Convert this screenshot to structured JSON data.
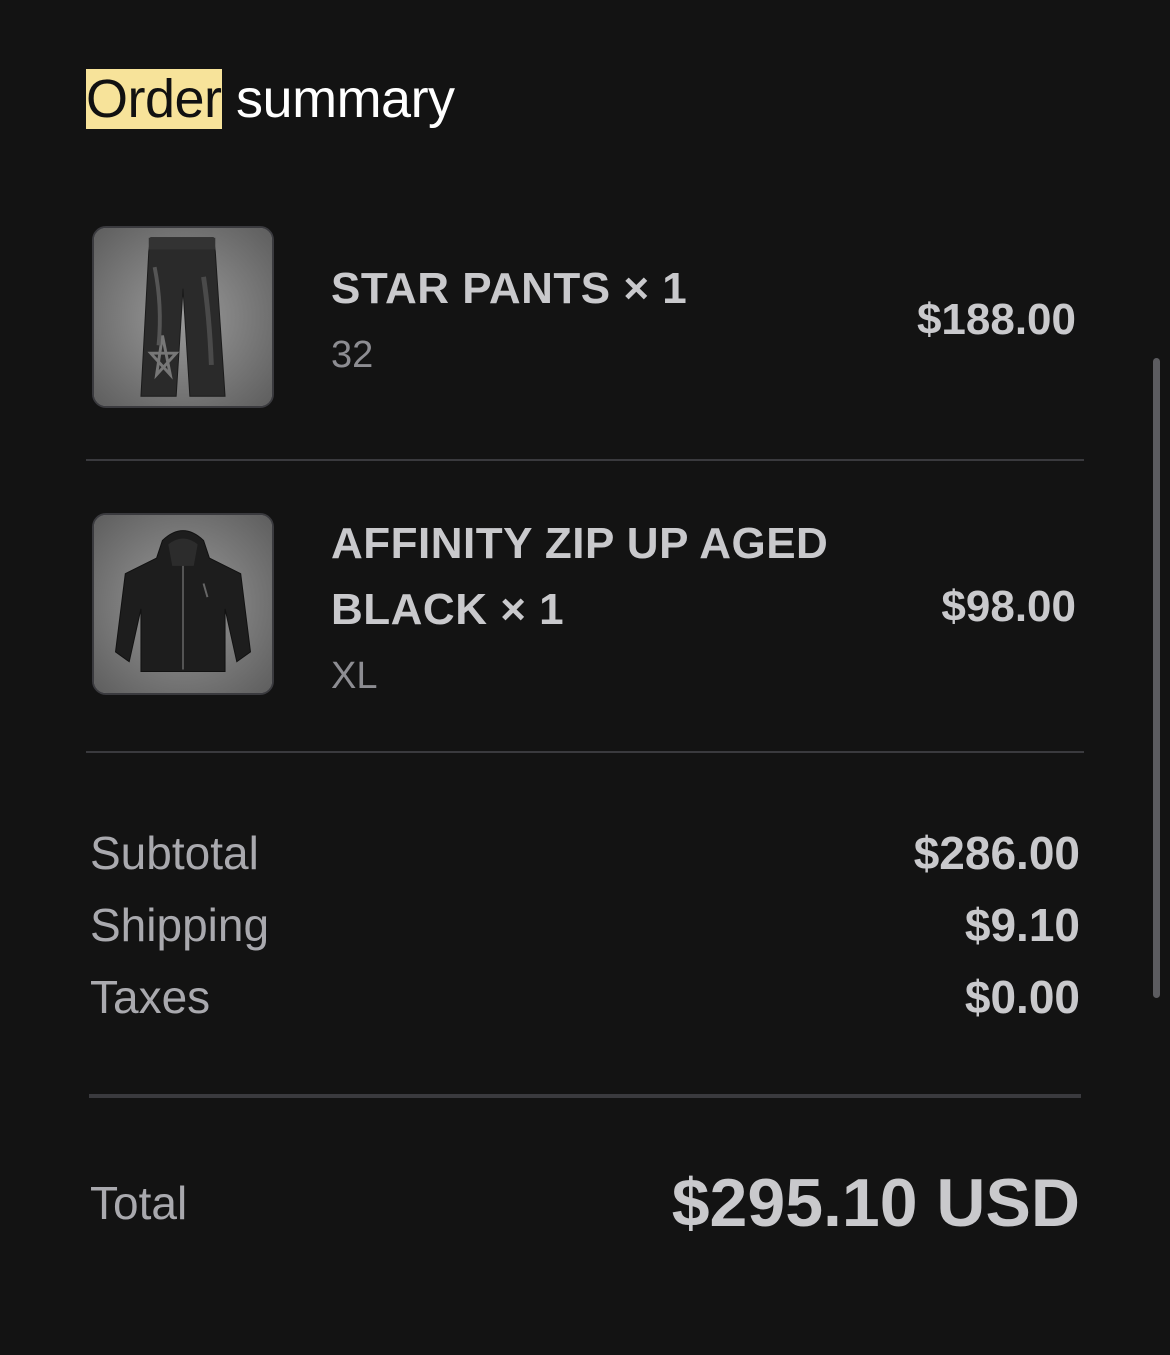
{
  "header": {
    "title_highlight": "Order",
    "title_rest": " summary"
  },
  "items": [
    {
      "name": "STAR PANTS × 1",
      "variant": "32",
      "price": "$188.00",
      "image": "star-pants-image"
    },
    {
      "name_line1": "AFFINITY ZIP UP AGED",
      "name_line2": "BLACK × 1",
      "variant": "XL",
      "price": "$98.00",
      "image": "zip-hoodie-image"
    }
  ],
  "summary": {
    "subtotal_label": "Subtotal",
    "subtotal_value": "$286.00",
    "shipping_label": "Shipping",
    "shipping_value": "$9.10",
    "taxes_label": "Taxes",
    "taxes_value": "$0.00"
  },
  "total": {
    "label": "Total",
    "value": "$295.10 USD"
  },
  "colors": {
    "background": "#131313",
    "highlight": "#f7e39a",
    "text_primary": "#c9c9cc",
    "text_secondary": "#8d8d92",
    "divider": "#3a3a3e"
  }
}
